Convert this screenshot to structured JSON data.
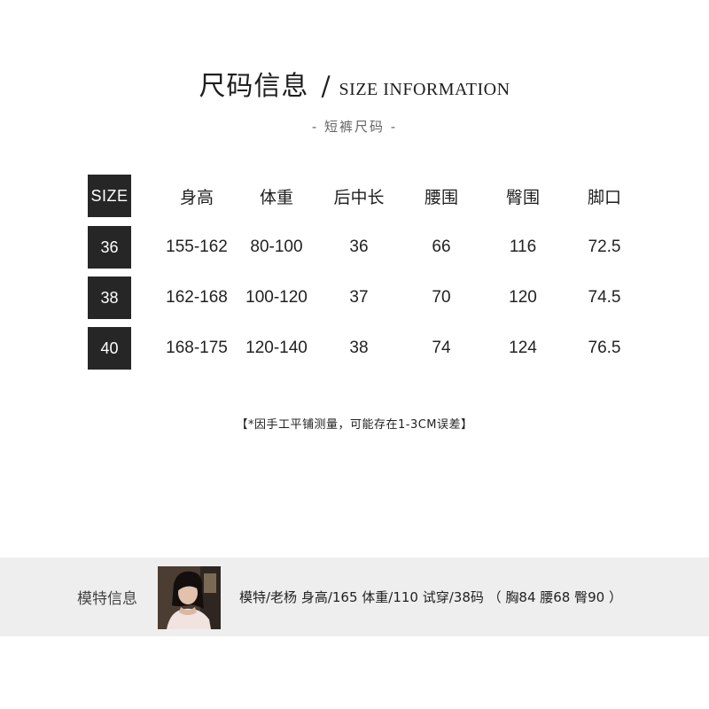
{
  "header": {
    "title_cn": "尺码信息",
    "slash": "/",
    "title_en": "SIZE INFORMATION",
    "subtitle": "- 短裤尺码 -"
  },
  "table": {
    "columns": [
      "SIZE",
      "身高",
      "体重",
      "后中长",
      "腰围",
      "臀围",
      "脚口"
    ],
    "rows": [
      {
        "size": "36",
        "cells": [
          "155-162",
          "80-100",
          "36",
          "66",
          "116",
          "72.5"
        ]
      },
      {
        "size": "38",
        "cells": [
          "162-168",
          "100-120",
          "37",
          "70",
          "120",
          "74.5"
        ]
      },
      {
        "size": "40",
        "cells": [
          "168-175",
          "120-140",
          "38",
          "74",
          "124",
          "76.5"
        ]
      }
    ]
  },
  "note": "【*因手工平铺测量，可能存在1-3CM误差】",
  "model": {
    "label": "模特信息",
    "photo_icon": "model-portrait",
    "info": "模特/老杨   身高/165   体重/110   试穿/38码 （ 胸84 腰68 臀90 ）"
  },
  "colors": {
    "size_box": "#262626",
    "model_bar": "#eeeeee"
  }
}
